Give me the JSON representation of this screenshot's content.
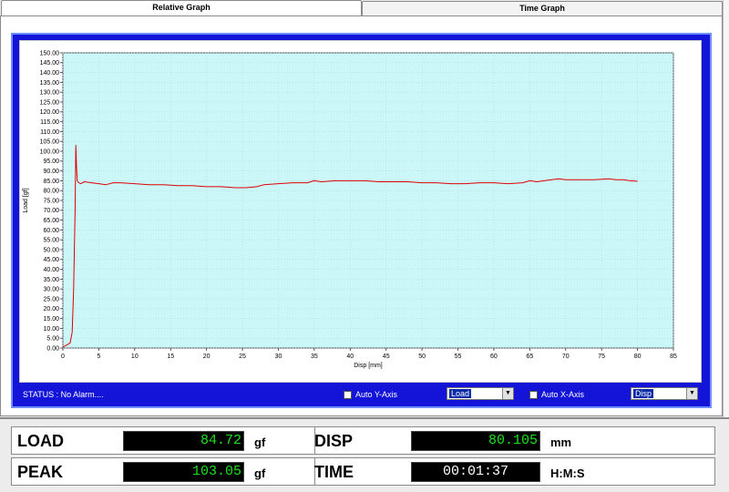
{
  "tabs": [
    {
      "label": "Relative Graph",
      "active": true
    },
    {
      "label": "Time Graph",
      "active": false
    }
  ],
  "status": "STATUS : No Alarm....",
  "controls": {
    "auto_y_label": "Auto Y-Axis",
    "auto_y_checked": false,
    "y_select": "Load",
    "auto_x_label": "Auto X-Axis",
    "auto_x_checked": false,
    "x_select": "Disp"
  },
  "readouts": {
    "load_label": "LOAD",
    "load_value": "84.72",
    "load_unit": "gf",
    "disp_label": "DISP",
    "disp_value": "80.105",
    "disp_unit": "mm",
    "peak_label": "PEAK",
    "peak_value": "103.05",
    "peak_unit": "gf",
    "time_label": "TIME",
    "time_value": "00:01:37",
    "time_unit": "H:M:S"
  },
  "colors": {
    "frame": "#1414d8",
    "plot_bg": "#ccf7f9",
    "line": "#e00000",
    "readout_text": "#1ce21c"
  },
  "chart_data": {
    "type": "line",
    "xlabel": "Disp [mm]",
    "ylabel": "Load [gf]",
    "xlim": [
      0,
      85
    ],
    "ylim": [
      0,
      150
    ],
    "x_ticks": [
      "0",
      "5",
      "10",
      "15",
      "20",
      "25",
      "30",
      "35",
      "40",
      "45",
      "50",
      "55",
      "60",
      "65",
      "70",
      "75",
      "80",
      "85"
    ],
    "y_ticks": [
      "0.00",
      "5.00",
      "10.00",
      "15.00",
      "20.00",
      "25.00",
      "30.00",
      "35.00",
      "40.00",
      "45.00",
      "50.00",
      "55.00",
      "60.00",
      "65.00",
      "70.00",
      "75.00",
      "80.00",
      "85.00",
      "90.00",
      "95.00",
      "100.00",
      "105.00",
      "110.00",
      "115.00",
      "120.00",
      "125.00",
      "130.00",
      "135.00",
      "140.00",
      "145.00",
      "150.00"
    ],
    "grid": true,
    "series": [
      {
        "x": [
          0,
          0.5,
          1.0,
          1.3,
          1.5,
          1.7,
          1.8,
          1.9,
          2.0,
          2.2,
          2.5,
          3,
          4,
          5,
          6,
          7,
          8,
          10,
          12,
          14,
          16,
          18,
          20,
          22,
          24,
          25.5,
          27,
          28,
          30,
          32,
          34,
          35,
          36,
          38,
          40,
          42,
          44,
          46,
          48,
          50,
          52,
          54,
          55,
          56,
          58,
          60,
          62,
          64,
          65,
          66,
          68,
          69,
          70,
          72,
          74,
          76,
          77,
          78,
          79,
          80
        ],
        "y": [
          0.5,
          1.5,
          2.5,
          8,
          30,
          70,
          103,
          92,
          85,
          84,
          83.5,
          84.5,
          84,
          83.5,
          83,
          84,
          84,
          83.5,
          83,
          83,
          82.5,
          82.5,
          82,
          82,
          81.5,
          81.5,
          82,
          83,
          83.5,
          84,
          84,
          85,
          84.5,
          85,
          85,
          85,
          84.5,
          84.5,
          84.5,
          84,
          84,
          83.5,
          83.5,
          83.5,
          84,
          84,
          83.5,
          84,
          85,
          84.5,
          85.5,
          86,
          85.5,
          85.5,
          85.5,
          86,
          85.5,
          85.5,
          85,
          84.7
        ]
      }
    ]
  }
}
